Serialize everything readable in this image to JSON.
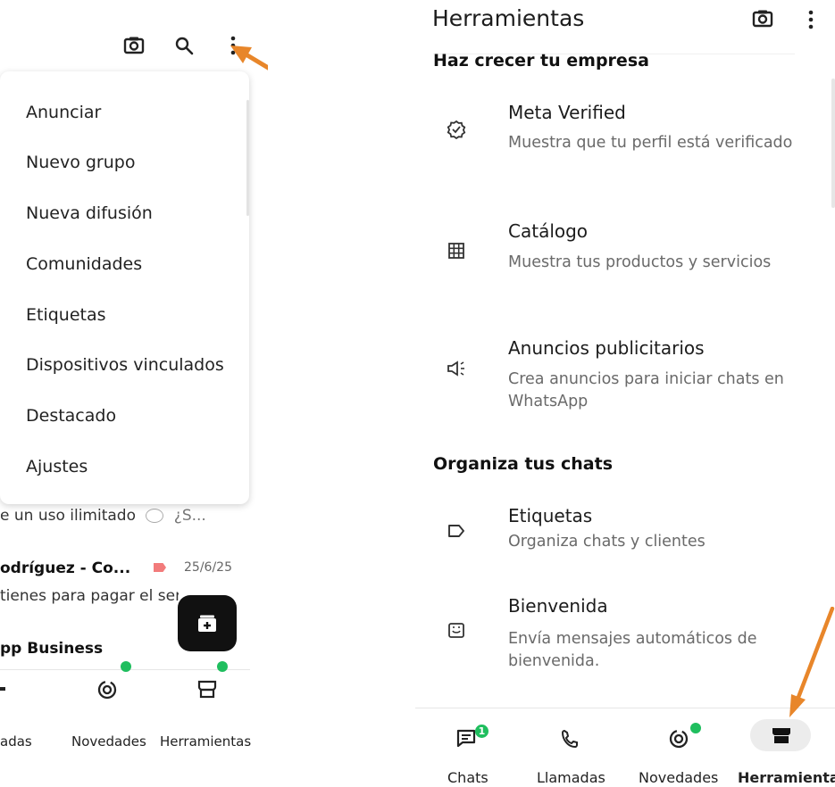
{
  "left": {
    "top_icons": [
      "camera-icon",
      "search-icon",
      "more-vert-icon"
    ],
    "menu": {
      "items": [
        "Anunciar",
        "Nuevo grupo",
        "Nueva difusión",
        "Comunidades",
        "Etiquetas",
        "Dispositivos vinculados",
        "Destacado",
        "Ajustes"
      ]
    },
    "chats": {
      "preview1": "e un uso ilimitado",
      "preview1_tail": "¿S...",
      "name2": "odríguez - Co...",
      "date2": "25/6/25",
      "preview2": "tienes para pagar el servi",
      "name3": "pp Business"
    },
    "nav": {
      "labels": [
        "adas",
        "Novedades",
        "Herramientas"
      ]
    }
  },
  "right": {
    "title": "Herramientas",
    "sections": [
      "Haz crecer tu empresa",
      "Organiza tus chats"
    ],
    "items": [
      {
        "icon": "verified-badge-icon",
        "title": "Meta Verified",
        "subtitle": "Muestra que tu perfil está verificado"
      },
      {
        "icon": "catalog-grid-icon",
        "title": "Catálogo",
        "subtitle": "Muestra tus productos y servicios"
      },
      {
        "icon": "megaphone-icon",
        "title": "Anuncios publicitarios",
        "subtitle": "Crea anuncios para iniciar chats en WhatsApp"
      },
      {
        "icon": "label-icon",
        "title": "Etiquetas",
        "subtitle": "Organiza chats y clientes"
      },
      {
        "icon": "greeting-message-icon",
        "title": "Bienvenida",
        "subtitle": "Envía mensajes automáticos de bienvenida."
      }
    ],
    "nav": {
      "items": [
        {
          "label": "Chats",
          "icon": "chats-icon",
          "badge": "1"
        },
        {
          "label": "Llamadas",
          "icon": "phone-icon"
        },
        {
          "label": "Novedades",
          "icon": "status-icon"
        },
        {
          "label": "Herramientas",
          "icon": "store-icon",
          "active": true
        }
      ]
    }
  },
  "colors": {
    "accent_green": "#1fbe5e",
    "annotation_arrow": "#e8862a",
    "label_tag": "#f27b7b"
  }
}
